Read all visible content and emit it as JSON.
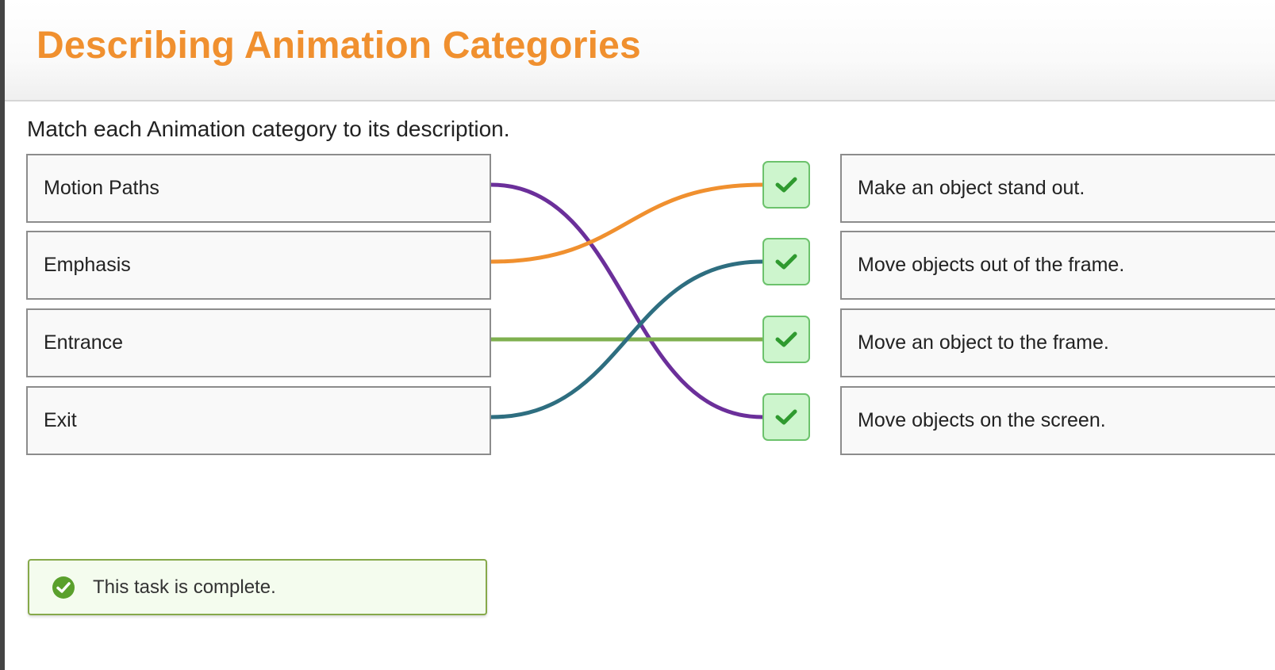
{
  "header": {
    "title": "Describing Animation Categories"
  },
  "instruction": "Match each Animation category to its description.",
  "left_items": [
    {
      "label": "Motion Paths"
    },
    {
      "label": "Emphasis"
    },
    {
      "label": "Entrance"
    },
    {
      "label": "Exit"
    }
  ],
  "right_items": [
    {
      "label": "Make an object stand out.",
      "status": "correct"
    },
    {
      "label": "Move objects out of the frame.",
      "status": "correct"
    },
    {
      "label": "Move an object to the frame.",
      "status": "correct"
    },
    {
      "label": "Move objects on the screen.",
      "status": "correct"
    }
  ],
  "matches": [
    {
      "from": "Motion Paths",
      "to": "Move objects on the screen.",
      "color": "#6b2f9a"
    },
    {
      "from": "Emphasis",
      "to": "Make an object stand out.",
      "color": "#f0902f"
    },
    {
      "from": "Entrance",
      "to": "Move an object to the frame.",
      "color": "#7fb04f"
    },
    {
      "from": "Exit",
      "to": "Move objects out of the frame.",
      "color": "#2e6e80"
    }
  ],
  "notice": {
    "text": "This task is complete.",
    "icon": "check-circle-icon"
  },
  "colors": {
    "accent": "#f0902f",
    "success": "#5aa02c"
  }
}
